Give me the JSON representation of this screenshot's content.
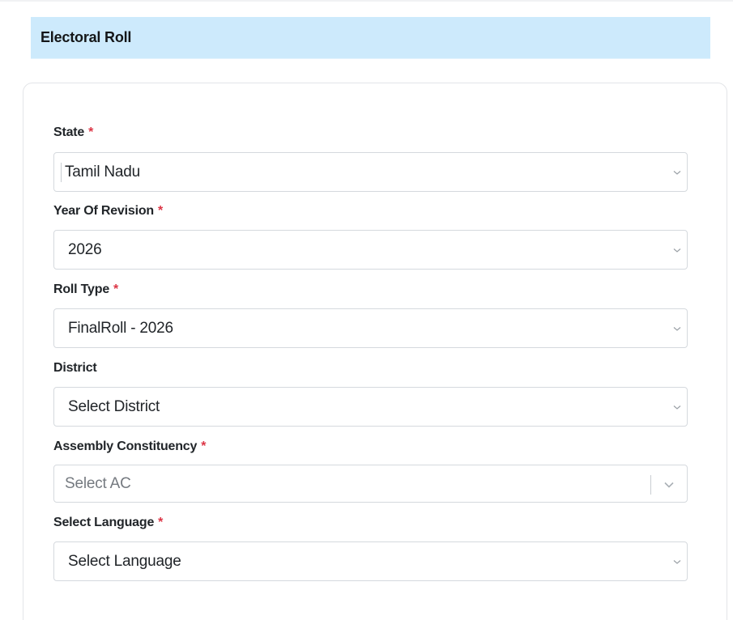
{
  "header": {
    "title": "Electoral Roll"
  },
  "required_mark": "*",
  "fields": {
    "state": {
      "label": "State",
      "required": true,
      "value": "Tamil Nadu"
    },
    "year": {
      "label": "Year Of Revision",
      "required": true,
      "value": "2026"
    },
    "roll_type": {
      "label": "Roll Type",
      "required": true,
      "value": "FinalRoll - 2026"
    },
    "district": {
      "label": "District",
      "required": false,
      "value": "Select District"
    },
    "ac": {
      "label": "Assembly Constituency",
      "required": true,
      "placeholder": "Select AC"
    },
    "language": {
      "label": "Select Language",
      "required": true,
      "value": "Select Language"
    }
  },
  "icons": {
    "dropdown": "chevron-down-icon"
  }
}
